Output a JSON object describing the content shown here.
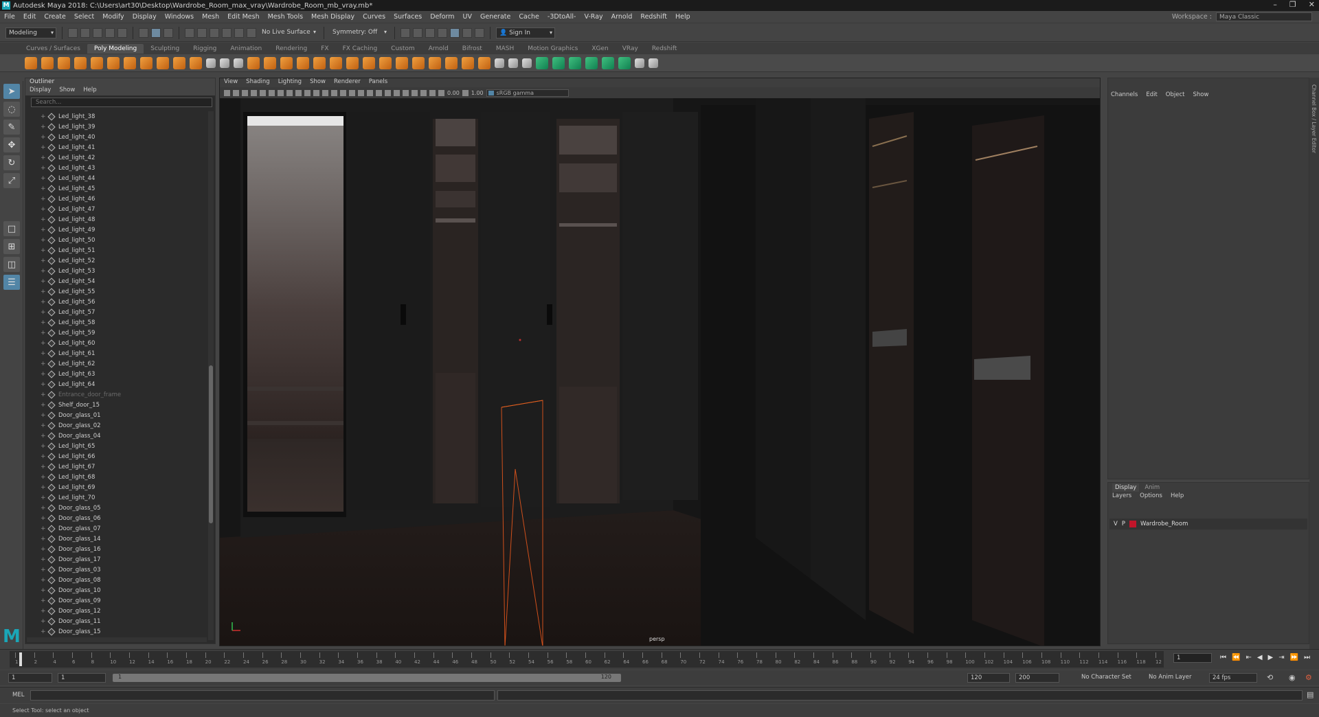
{
  "title": "Autodesk Maya 2018: C:\\Users\\art30\\Desktop\\Wardrobe_Room_max_vray\\Wardrobe_Room_mb_vray.mb*",
  "menu": [
    "File",
    "Edit",
    "Create",
    "Select",
    "Modify",
    "Display",
    "Windows",
    "Mesh",
    "Edit Mesh",
    "Mesh Tools",
    "Mesh Display",
    "Curves",
    "Surfaces",
    "Deform",
    "UV",
    "Generate",
    "Cache",
    "-3DtoAll-",
    "V-Ray",
    "Arnold",
    "Redshift",
    "Help"
  ],
  "workspace": {
    "label": "Workspace :",
    "value": "Maya Classic"
  },
  "statusline": {
    "mode": "Modeling",
    "live_surface": "No Live Surface",
    "symmetry": "Symmetry: Off",
    "sign_in": "Sign In"
  },
  "shelf_tabs": [
    "Curves / Surfaces",
    "Poly Modeling",
    "Sculpting",
    "Rigging",
    "Animation",
    "Rendering",
    "FX",
    "FX Caching",
    "Custom",
    "Arnold",
    "Bifrost",
    "MASH",
    "Motion Graphics",
    "XGen",
    "VRay",
    "Redshift"
  ],
  "shelf_active": "Poly Modeling",
  "outliner": {
    "title": "Outliner",
    "menu": [
      "Display",
      "Show",
      "Help"
    ],
    "search_placeholder": "Search...",
    "items": [
      "Led_light_38",
      "Led_light_39",
      "Led_light_40",
      "Led_light_41",
      "Led_light_42",
      "Led_light_43",
      "Led_light_44",
      "Led_light_45",
      "Led_light_46",
      "Led_light_47",
      "Led_light_48",
      "Led_light_49",
      "Led_light_50",
      "Led_light_51",
      "Led_light_52",
      "Led_light_53",
      "Led_light_54",
      "Led_light_55",
      "Led_light_56",
      "Led_light_57",
      "Led_light_58",
      "Led_light_59",
      "Led_light_60",
      "Led_light_61",
      "Led_light_62",
      "Led_light_63",
      "Led_light_64",
      "Entrance_door_frame",
      "Shelf_door_15",
      "Door_glass_01",
      "Door_glass_02",
      "Door_glass_04",
      "Led_light_65",
      "Led_light_66",
      "Led_light_67",
      "Led_light_68",
      "Led_light_69",
      "Led_light_70",
      "Door_glass_05",
      "Door_glass_06",
      "Door_glass_07",
      "Door_glass_14",
      "Door_glass_16",
      "Door_glass_17",
      "Door_glass_03",
      "Door_glass_08",
      "Door_glass_10",
      "Door_glass_09",
      "Door_glass_12",
      "Door_glass_11",
      "Door_glass_15"
    ],
    "dim_item": "Entrance_door_frame"
  },
  "viewport": {
    "menu": [
      "View",
      "Shading",
      "Lighting",
      "Show",
      "Renderer",
      "Panels"
    ],
    "exposure": "0.00",
    "gamma": "1.00",
    "color_space": "sRGB gamma",
    "camera": "persp"
  },
  "channel_box": {
    "menu": [
      "Channels",
      "Edit",
      "Object",
      "Show"
    ],
    "side_label": "Channel Box / Layer Editor"
  },
  "layer_editor": {
    "tabs": [
      "Display",
      "Anim"
    ],
    "menu": [
      "Layers",
      "Options",
      "Help"
    ],
    "layer": {
      "v": "V",
      "p": "P",
      "name": "Wardrobe_Room",
      "color": "#c0152a"
    }
  },
  "timeline": {
    "ticks": [
      "1",
      "2",
      "4",
      "6",
      "8",
      "10",
      "12",
      "14",
      "16",
      "18",
      "20",
      "22",
      "24",
      "26",
      "28",
      "30",
      "32",
      "34",
      "36",
      "38",
      "40",
      "42",
      "44",
      "46",
      "48",
      "50",
      "52",
      "54",
      "56",
      "58",
      "60",
      "62",
      "64",
      "66",
      "68",
      "70",
      "72",
      "74",
      "76",
      "78",
      "80",
      "82",
      "84",
      "86",
      "88",
      "90",
      "92",
      "94",
      "96",
      "98",
      "100",
      "102",
      "104",
      "106",
      "108",
      "110",
      "112",
      "114",
      "116",
      "118",
      "12"
    ],
    "current": "1"
  },
  "range": {
    "start": "1",
    "start2": "1",
    "bar_start": "1",
    "bar_end": "120",
    "end": "120",
    "end2": "200",
    "char_set": "No Character Set",
    "anim_layer": "No Anim Layer",
    "fps": "24 fps"
  },
  "cmdline": {
    "label": "MEL"
  },
  "help": "Select Tool: select an object"
}
